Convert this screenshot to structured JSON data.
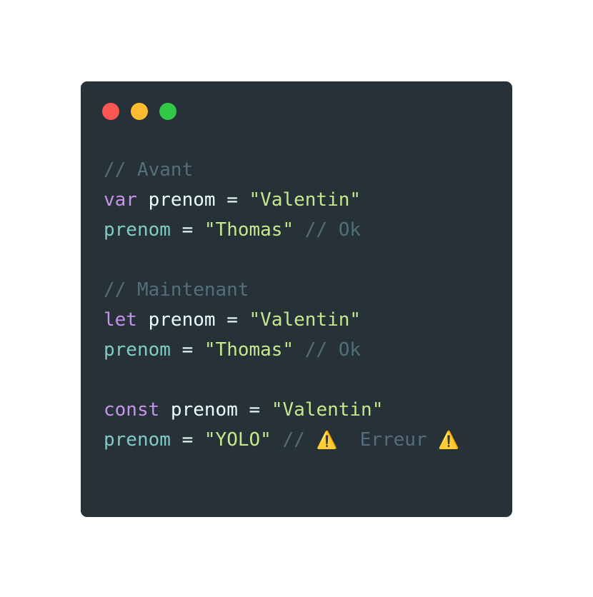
{
  "window": {
    "traffic_lights": [
      {
        "name": "close",
        "color": "#fc5753"
      },
      {
        "name": "minimize",
        "color": "#fdbc2f"
      },
      {
        "name": "zoom",
        "color": "#33c748"
      }
    ]
  },
  "colors": {
    "background": "#263238",
    "comment": "#546e7a",
    "keyword": "#c792ea",
    "identifier": "#eeffff",
    "assigned_identifier": "#80cbc4",
    "operator": "#eeffff",
    "string": "#c3e88d",
    "warning": "#ffcc00"
  },
  "code": {
    "lines": [
      [
        {
          "t": "// Avant",
          "k": "comment"
        }
      ],
      [
        {
          "t": "var",
          "k": "keyword"
        },
        {
          "t": " prenom ",
          "k": "identifier"
        },
        {
          "t": "=",
          "k": "operator"
        },
        {
          "t": " ",
          "k": "identifier"
        },
        {
          "t": "\"Valentin\"",
          "k": "string"
        }
      ],
      [
        {
          "t": "prenom",
          "k": "assigned_identifier"
        },
        {
          "t": " = ",
          "k": "operator"
        },
        {
          "t": "\"Thomas\"",
          "k": "string"
        },
        {
          "t": " // Ok",
          "k": "comment"
        }
      ],
      [],
      [
        {
          "t": "// Maintenant",
          "k": "comment"
        }
      ],
      [
        {
          "t": "let",
          "k": "keyword"
        },
        {
          "t": " prenom ",
          "k": "identifier"
        },
        {
          "t": "=",
          "k": "operator"
        },
        {
          "t": " ",
          "k": "identifier"
        },
        {
          "t": "\"Valentin\"",
          "k": "string"
        }
      ],
      [
        {
          "t": "prenom",
          "k": "assigned_identifier"
        },
        {
          "t": " = ",
          "k": "operator"
        },
        {
          "t": "\"Thomas\"",
          "k": "string"
        },
        {
          "t": " // Ok",
          "k": "comment"
        }
      ],
      [],
      [
        {
          "t": "const",
          "k": "keyword"
        },
        {
          "t": " prenom ",
          "k": "identifier"
        },
        {
          "t": "=",
          "k": "operator"
        },
        {
          "t": " ",
          "k": "identifier"
        },
        {
          "t": "\"Valentin\"",
          "k": "string"
        }
      ],
      [
        {
          "t": "prenom",
          "k": "assigned_identifier"
        },
        {
          "t": " = ",
          "k": "operator"
        },
        {
          "t": "\"YOLO\"",
          "k": "string"
        },
        {
          "t": " // ",
          "k": "comment"
        },
        {
          "t": "⚠️",
          "k": "warning",
          "icon": "warning-icon"
        },
        {
          "t": "  Erreur ",
          "k": "comment"
        },
        {
          "t": "⚠️",
          "k": "warning",
          "icon": "warning-icon"
        }
      ]
    ]
  }
}
